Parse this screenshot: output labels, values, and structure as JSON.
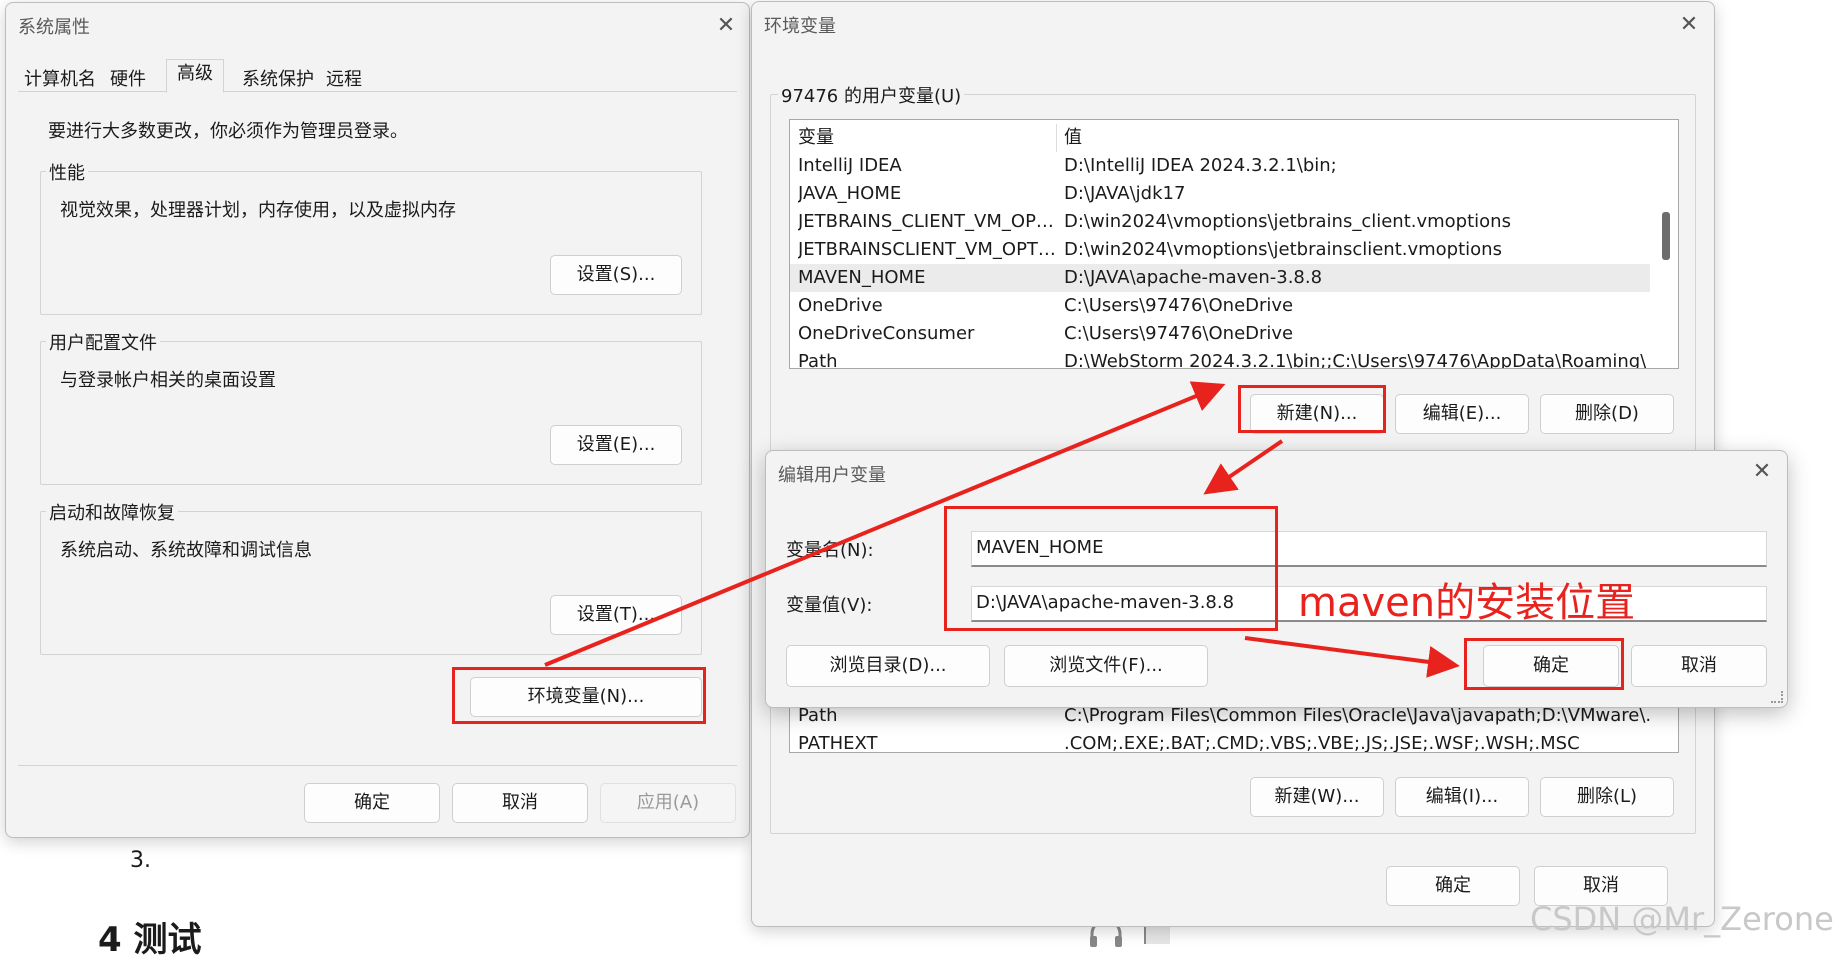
{
  "sysprops": {
    "title": "系统属性",
    "tabs": [
      "计算机名",
      "硬件",
      "高级",
      "系统保护",
      "远程"
    ],
    "admin_note": "要进行大多数更改，你必须作为管理员登录。",
    "perf": {
      "title": "性能",
      "desc": "视觉效果，处理器计划，内存使用，以及虚拟内存",
      "button": "设置(S)..."
    },
    "profile": {
      "title": "用户配置文件",
      "desc": "与登录帐户相关的桌面设置",
      "button": "设置(E)..."
    },
    "startup": {
      "title": "启动和故障恢复",
      "desc": "系统启动、系统故障和调试信息",
      "button": "设置(T)..."
    },
    "env_button": "环境变量(N)...",
    "ok": "确定",
    "cancel": "取消",
    "apply": "应用(A)"
  },
  "envvars": {
    "title": "环境变量",
    "user_section": "97476 的用户变量(U)",
    "col_var": "变量",
    "col_val": "值",
    "user_rows": [
      {
        "name": "IntelliJ IDEA",
        "value": "D:\\IntelliJ IDEA 2024.3.2.1\\bin;"
      },
      {
        "name": "JAVA_HOME",
        "value": "D:\\JAVA\\jdk17"
      },
      {
        "name": "JETBRAINS_CLIENT_VM_OPT...",
        "value": "D:\\win2024\\vmoptions\\jetbrains_client.vmoptions"
      },
      {
        "name": "JETBRAINSCLIENT_VM_OPTI...",
        "value": "D:\\win2024\\vmoptions\\jetbrainsclient.vmoptions"
      },
      {
        "name": "MAVEN_HOME",
        "value": "D:\\JAVA\\apache-maven-3.8.8"
      },
      {
        "name": "OneDrive",
        "value": "C:\\Users\\97476\\OneDrive"
      },
      {
        "name": "OneDriveConsumer",
        "value": "C:\\Users\\97476\\OneDrive"
      },
      {
        "name": "Path",
        "value": "D:\\WebStorm 2024.3.2.1\\bin;;C:\\Users\\97476\\AppData\\Roaming\\"
      }
    ],
    "new_user": "新建(N)...",
    "edit_user": "编辑(E)...",
    "delete_user": "删除(D)",
    "sys_rows": [
      {
        "name": "Path",
        "value": "C:\\Program Files\\Common Files\\Oracle\\Java\\javapath;D:\\VMware\\..."
      },
      {
        "name": "PATHEXT",
        "value": ".COM;.EXE;.BAT;.CMD;.VBS;.VBE;.JS;.JSE;.WSF;.WSH;.MSC"
      }
    ],
    "new_sys": "新建(W)...",
    "edit_sys": "编辑(I)...",
    "delete_sys": "删除(L)",
    "ok": "确定",
    "cancel": "取消"
  },
  "edit_dialog": {
    "title": "编辑用户变量",
    "name_label": "变量名(N):",
    "name_value": "MAVEN_HOME",
    "value_label": "变量值(V):",
    "value_value": "D:\\JAVA\\apache-maven-3.8.8",
    "browse_dir": "浏览目录(D)...",
    "browse_file": "浏览文件(F)...",
    "ok": "确定",
    "cancel": "取消"
  },
  "annotation": {
    "text": "maven的安装位置",
    "color": "#e8231d"
  },
  "background": {
    "step": "3.",
    "heading": "4 测试"
  },
  "watermark": "CSDN @Mr_Zerone",
  "accent": "#e8231d"
}
